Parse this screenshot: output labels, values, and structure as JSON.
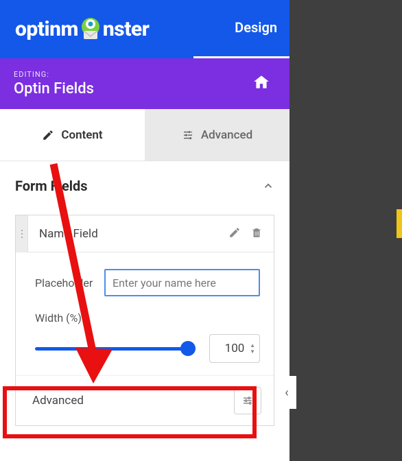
{
  "brand": {
    "name_left": "optinm",
    "name_right": "nster"
  },
  "nav": {
    "design": "Design"
  },
  "editing": {
    "label": "EDITING:",
    "title": "Optin Fields"
  },
  "tabs": {
    "content": "Content",
    "advanced": "Advanced"
  },
  "section": {
    "form_fields": "Form Fields"
  },
  "field": {
    "title": "Name Field",
    "placeholder_label": "Placeholder",
    "placeholder_value": "Enter your name here",
    "width_label": "Width (%)",
    "width_value": "100",
    "advanced_label": "Advanced"
  }
}
